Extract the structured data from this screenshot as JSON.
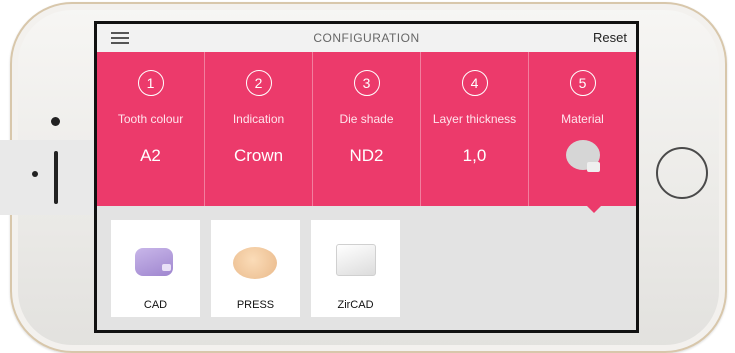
{
  "header": {
    "title": "CONFIGURATION",
    "reset_label": "Reset"
  },
  "steps": [
    {
      "number": "1",
      "label": "Tooth colour",
      "value": "A2"
    },
    {
      "number": "2",
      "label": "Indication",
      "value": "Crown"
    },
    {
      "number": "3",
      "label": "Die shade",
      "value": "ND2"
    },
    {
      "number": "4",
      "label": "Layer thickness",
      "value": "1,0"
    },
    {
      "number": "5",
      "label": "Material",
      "value": ""
    }
  ],
  "materials": [
    {
      "label": "CAD"
    },
    {
      "label": "PRESS"
    },
    {
      "label": "ZirCAD"
    }
  ],
  "colors": {
    "accent": "#ec3a6b",
    "topbar": "#f2f2f2",
    "content_bg": "#e3e3e3"
  }
}
